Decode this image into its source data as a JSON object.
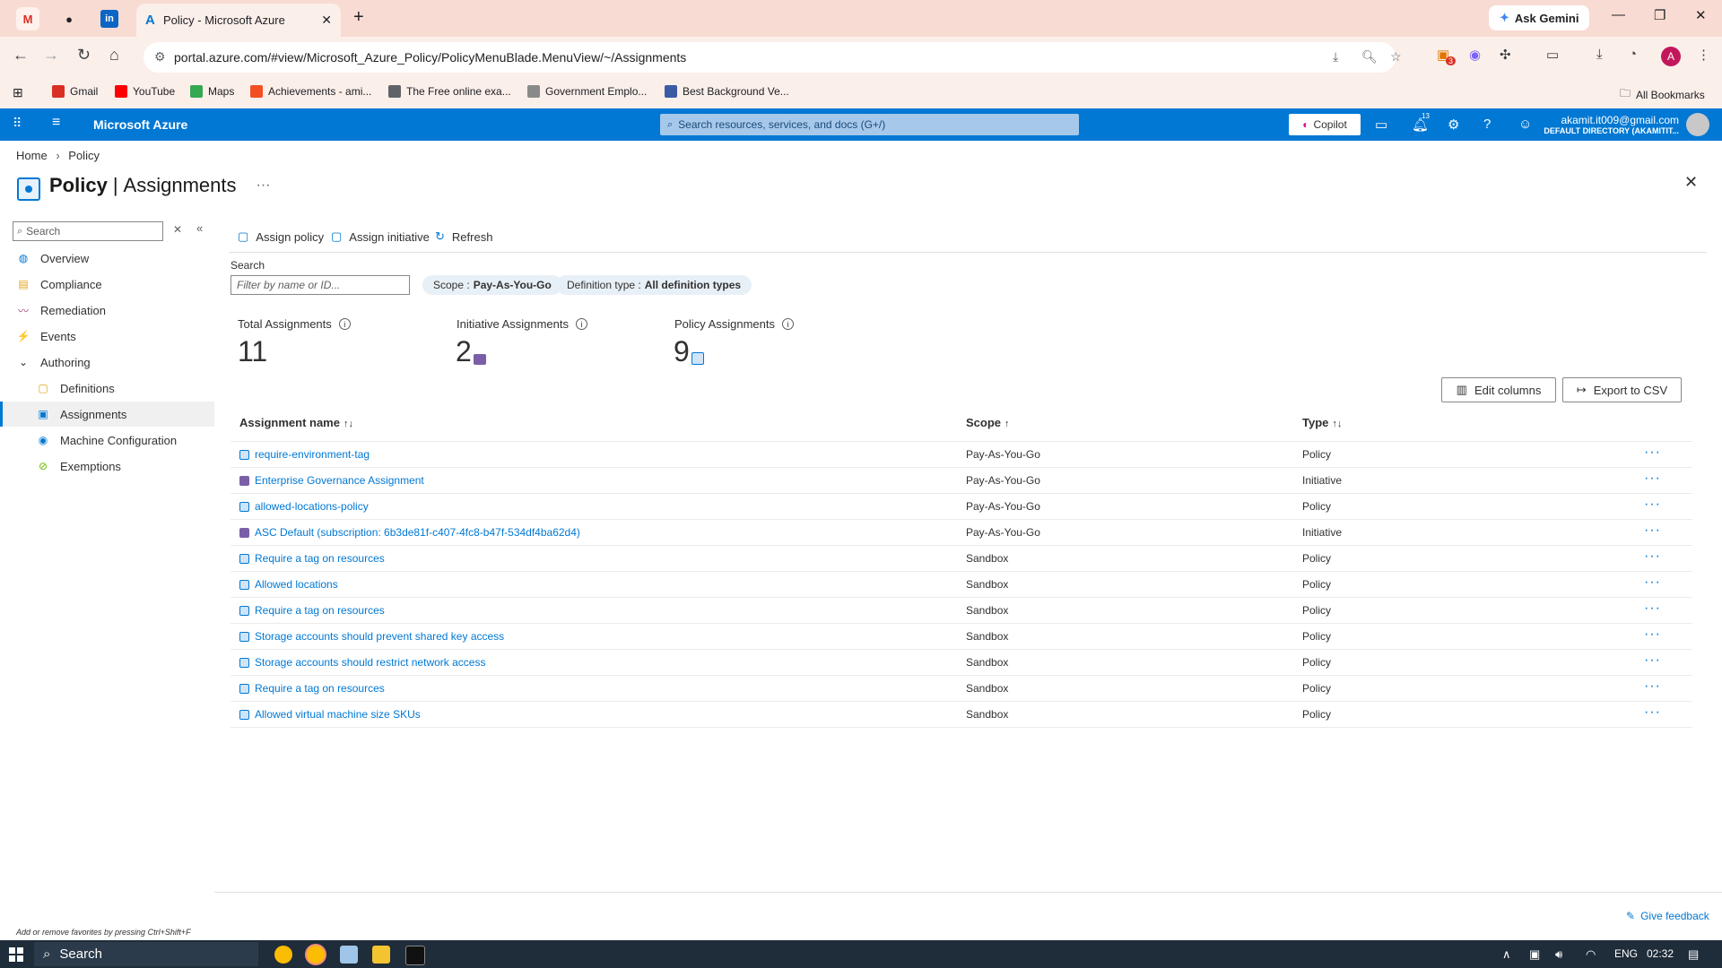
{
  "browser": {
    "tab_title": "Policy - Microsoft Azure",
    "url": "portal.azure.com/#view/Microsoft_Azure_Policy/PolicyMenuBlade.MenuView/~/Assignments",
    "gemini_label": "Ask Gemini",
    "profile_initial": "A",
    "extension_badge": "3",
    "bookmarks": [
      {
        "label": "Gmail",
        "icon": "gmail-icon",
        "color": "#d93025"
      },
      {
        "label": "YouTube",
        "icon": "youtube-icon",
        "color": "#ff0000"
      },
      {
        "label": "Maps",
        "icon": "maps-icon",
        "color": "#34a853"
      },
      {
        "label": "Achievements - ami...",
        "icon": "microsoft-icon",
        "color": "#f25022"
      },
      {
        "label": "The Free online exa...",
        "icon": "globe-icon",
        "color": "#5f6368"
      },
      {
        "label": "Government Emplo...",
        "icon": "gov-icon",
        "color": "#8a8a8a"
      },
      {
        "label": "Best Background Ve...",
        "icon": "bg-icon",
        "color": "#3b5ba5"
      }
    ],
    "all_bookmarks": "All Bookmarks"
  },
  "azure": {
    "brand": "Microsoft Azure",
    "search_placeholder": "Search resources, services, and docs (G+/)",
    "copilot": "Copilot",
    "notifications_count": "13",
    "account_email": "akamit.it009@gmail.com",
    "account_directory": "DEFAULT DIRECTORY (AKAMITIT..."
  },
  "breadcrumb": [
    "Home",
    "Policy"
  ],
  "page": {
    "title_main": "Policy",
    "title_sep": "|",
    "title_sub": "Assignments",
    "more": "···"
  },
  "sidebar": {
    "search_placeholder": "Search",
    "items": [
      {
        "label": "Overview",
        "icon": "overview-icon",
        "indent": 0
      },
      {
        "label": "Compliance",
        "icon": "compliance-icon",
        "indent": 0
      },
      {
        "label": "Remediation",
        "icon": "remediation-icon",
        "indent": 0
      },
      {
        "label": "Events",
        "icon": "events-icon",
        "indent": 0
      },
      {
        "label": "Authoring",
        "icon": "chevron-down-icon",
        "indent": 0
      },
      {
        "label": "Definitions",
        "icon": "definitions-icon",
        "indent": 1
      },
      {
        "label": "Assignments",
        "icon": "assignments-icon",
        "indent": 1,
        "selected": true
      },
      {
        "label": "Machine Configuration",
        "icon": "machine-config-icon",
        "indent": 1
      },
      {
        "label": "Exemptions",
        "icon": "exemptions-icon",
        "indent": 1
      }
    ]
  },
  "commands": {
    "assign_policy": "Assign policy",
    "assign_initiative": "Assign initiative",
    "refresh": "Refresh"
  },
  "filters": {
    "search_label": "Search",
    "search_placeholder": "Filter by name or ID...",
    "scope_key": "Scope :",
    "scope_value": "Pay-As-You-Go",
    "deftype_key": "Definition type :",
    "deftype_value": "All definition types"
  },
  "summary": {
    "total_label": "Total Assignments",
    "total_value": "11",
    "initiative_label": "Initiative Assignments",
    "initiative_value": "2",
    "policy_label": "Policy Assignments",
    "policy_value": "9"
  },
  "actions": {
    "edit_columns": "Edit columns",
    "export_csv": "Export to CSV"
  },
  "table": {
    "headers": {
      "name": "Assignment name",
      "scope": "Scope",
      "type": "Type"
    },
    "sort": {
      "name": "↑↓",
      "scope": "↑",
      "type": "↑↓"
    },
    "rows": [
      {
        "name": "require-environment-tag",
        "scope": "Pay-As-You-Go",
        "type": "Policy",
        "more": "···"
      },
      {
        "name": "Enterprise Governance Assignment",
        "scope": "Pay-As-You-Go",
        "type": "Initiative",
        "more": "···"
      },
      {
        "name": "allowed-locations-policy",
        "scope": "Pay-As-You-Go",
        "type": "Policy",
        "more": "···"
      },
      {
        "name": "ASC Default (subscription: 6b3de81f-c407-4fc8-b47f-534df4ba62d4)",
        "scope": "Pay-As-You-Go",
        "type": "Initiative",
        "more": "···"
      },
      {
        "name": "Require a tag on resources",
        "scope": "Sandbox",
        "type": "Policy",
        "more": "···"
      },
      {
        "name": "Allowed locations",
        "scope": "Sandbox",
        "type": "Policy",
        "more": "···"
      },
      {
        "name": "Require a tag on resources",
        "scope": "Sandbox",
        "type": "Policy",
        "more": "···"
      },
      {
        "name": "Storage accounts should prevent shared key access",
        "scope": "Sandbox",
        "type": "Policy",
        "more": "···"
      },
      {
        "name": "Storage accounts should restrict network access",
        "scope": "Sandbox",
        "type": "Policy",
        "more": "···"
      },
      {
        "name": "Require a tag on resources",
        "scope": "Sandbox",
        "type": "Policy",
        "more": "···"
      },
      {
        "name": "Allowed virtual machine size SKUs",
        "scope": "Sandbox",
        "type": "Policy",
        "more": "···"
      }
    ]
  },
  "footer": {
    "feedback": "Give feedback",
    "favorites_hint": "Add or remove favorites by pressing Ctrl+Shift+F"
  },
  "taskbar": {
    "search": "Search",
    "lang": "ENG",
    "time": "02:32"
  },
  "colors": {
    "azure_blue": "#0078d4",
    "tabstrip": "#f8dbd2",
    "taskbar": "#1f2c3a",
    "initiative_icon": "#7a5fa8"
  }
}
